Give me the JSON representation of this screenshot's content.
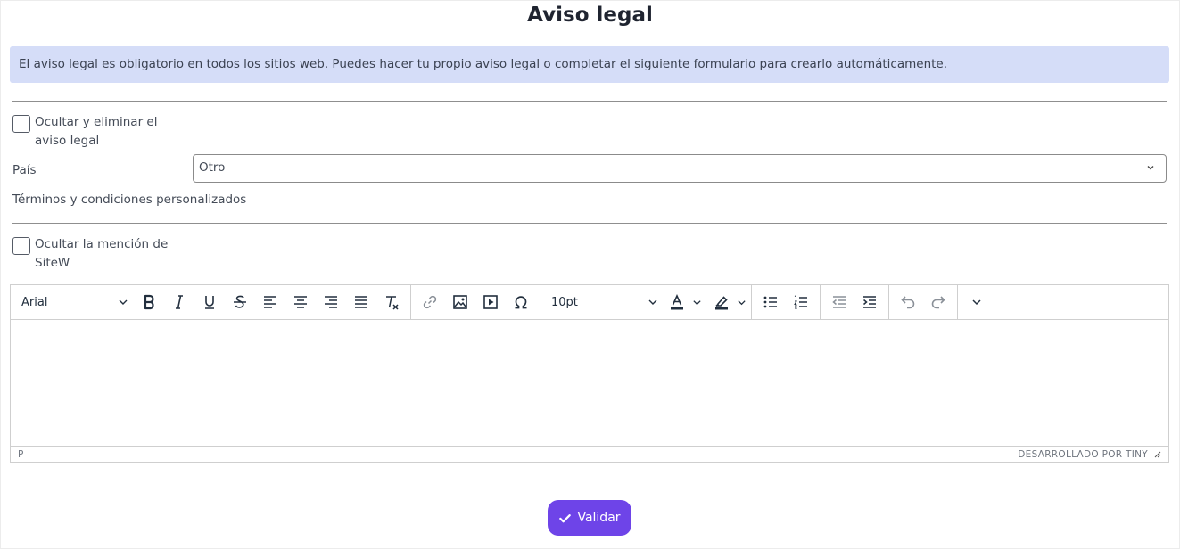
{
  "page": {
    "title": "Aviso legal",
    "notice": "El aviso legal es obligatorio en todos los sitios web. Puedes hacer tu propio aviso legal o completar el siguiente formulario para crearlo automáticamente."
  },
  "form": {
    "hide_notice_label": "Ocultar y eliminar el aviso legal",
    "country_label": "País",
    "country_value": "Otro",
    "custom_terms_label": "Términos y condiciones personalizados",
    "hide_mention_label": "Ocultar la mención de SiteW"
  },
  "editor": {
    "font_family": "Arial",
    "font_size": "10pt",
    "status_path": "P",
    "branding": "DESARROLLADO POR TINY",
    "colors": {
      "text_color_bar": "#222f3e",
      "highlight_bar": "#222f3e"
    }
  },
  "actions": {
    "validate_label": "Validar"
  },
  "colors": {
    "accent": "#6e44e8",
    "notice_bg": "#d5ddf8"
  }
}
